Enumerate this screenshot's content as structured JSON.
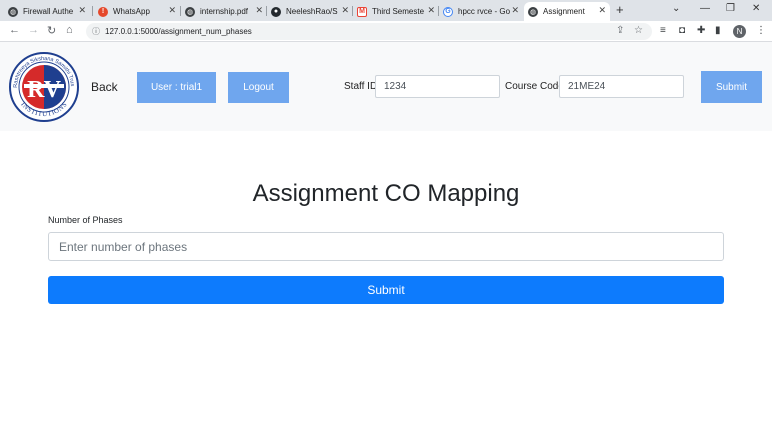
{
  "browser": {
    "tabs": [
      {
        "label": "Firewall Authe",
        "favicon": "globe-icon",
        "color": "#5f6368"
      },
      {
        "label": "WhatsApp",
        "favicon": "whatsapp-alert-icon",
        "color": "#e5482b"
      },
      {
        "label": "internship.pdf",
        "favicon": "globe-icon",
        "color": "#5f6368"
      },
      {
        "label": "NeeleshRao/S",
        "favicon": "github-icon",
        "color": "#24292e"
      },
      {
        "label": "Third Semeste",
        "favicon": "gmail-icon",
        "color": "#ea4335"
      },
      {
        "label": "hpcc rvce - Go",
        "favicon": "google-icon",
        "color": "#4285f4"
      },
      {
        "label": "Assignment",
        "favicon": "globe-icon",
        "color": "#5f6368",
        "active": true
      }
    ],
    "new_tab": "+",
    "url": "127.0.0.1:5000/assignment_num_phases",
    "profile_initial": "N"
  },
  "header": {
    "logo_letters": "RV",
    "logo_text_top": "Rashtreeya Sikshana Samithi Trust",
    "logo_text_bottom": "INSTITUTIONS",
    "back_label": "Back",
    "user_label": "User : trial1",
    "logout_label": "Logout",
    "staff_id_label": "Staff ID",
    "staff_id_value": "1234",
    "course_code_label": "Course Code",
    "course_code_value": "21ME24",
    "submit_label": "Submit",
    "button_color": "#6fa6ee"
  },
  "main": {
    "title": "Assignment CO Mapping",
    "phases_label": "Number of Phases",
    "phases_placeholder": "Enter number of phases",
    "submit_label": "Submit",
    "submit_color": "#0d7bfd"
  }
}
